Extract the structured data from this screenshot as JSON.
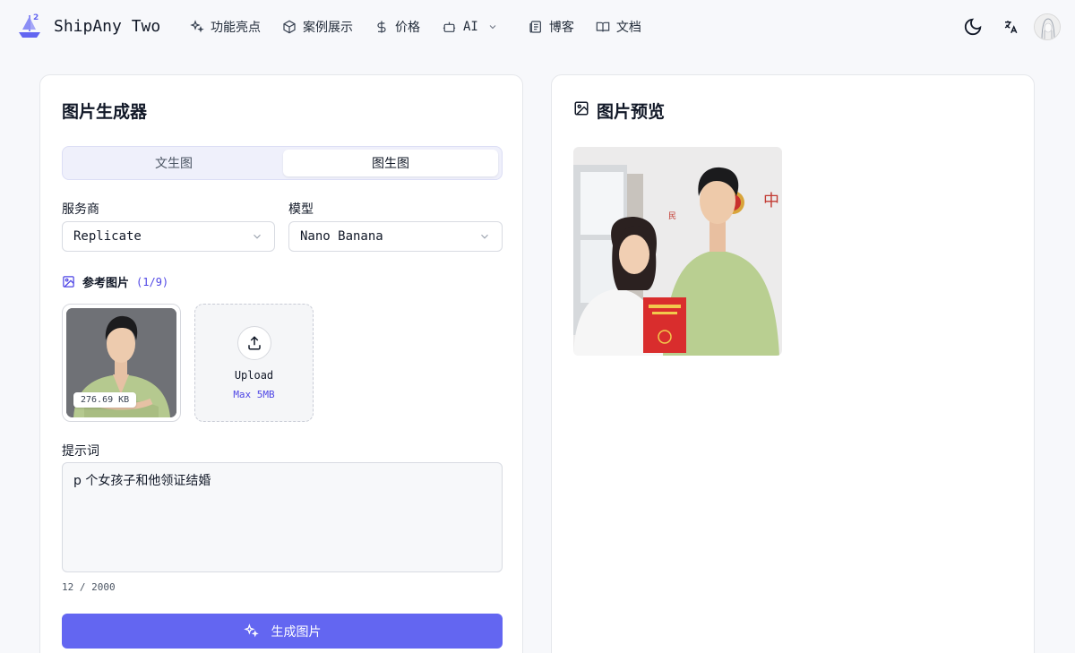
{
  "header": {
    "brand": "ShipAny Two",
    "nav": [
      {
        "label": "功能亮点",
        "icon": "sparkles-icon"
      },
      {
        "label": "案例展示",
        "icon": "cube-icon"
      },
      {
        "label": "价格",
        "icon": "dollar-icon"
      },
      {
        "label": "AI",
        "icon": "bot-icon"
      },
      {
        "label": "博客",
        "icon": "newspaper-icon"
      },
      {
        "label": "文档",
        "icon": "book-icon"
      }
    ]
  },
  "generator": {
    "title": "图片生成器",
    "tabs": [
      "文生图",
      "图生图"
    ],
    "active_tab": "图生图",
    "provider_label": "服务商",
    "provider_value": "Replicate",
    "model_label": "模型",
    "model_value": "Nano Banana",
    "ref_label": "参考图片",
    "ref_count": "(1/9)",
    "ref_size": "276.69 KB",
    "upload_title": "Upload",
    "upload_sub": "Max 5MB",
    "prompt_label": "提示词",
    "prompt_value": "p 个女孩子和他领证结婚",
    "char_count": "12 / 2000",
    "generate_label": "生成图片"
  },
  "preview": {
    "title": "图片预览"
  },
  "colors": {
    "accent": "#6366f1",
    "accent_text": "#4f46e5",
    "background": "#f7f8fb"
  }
}
